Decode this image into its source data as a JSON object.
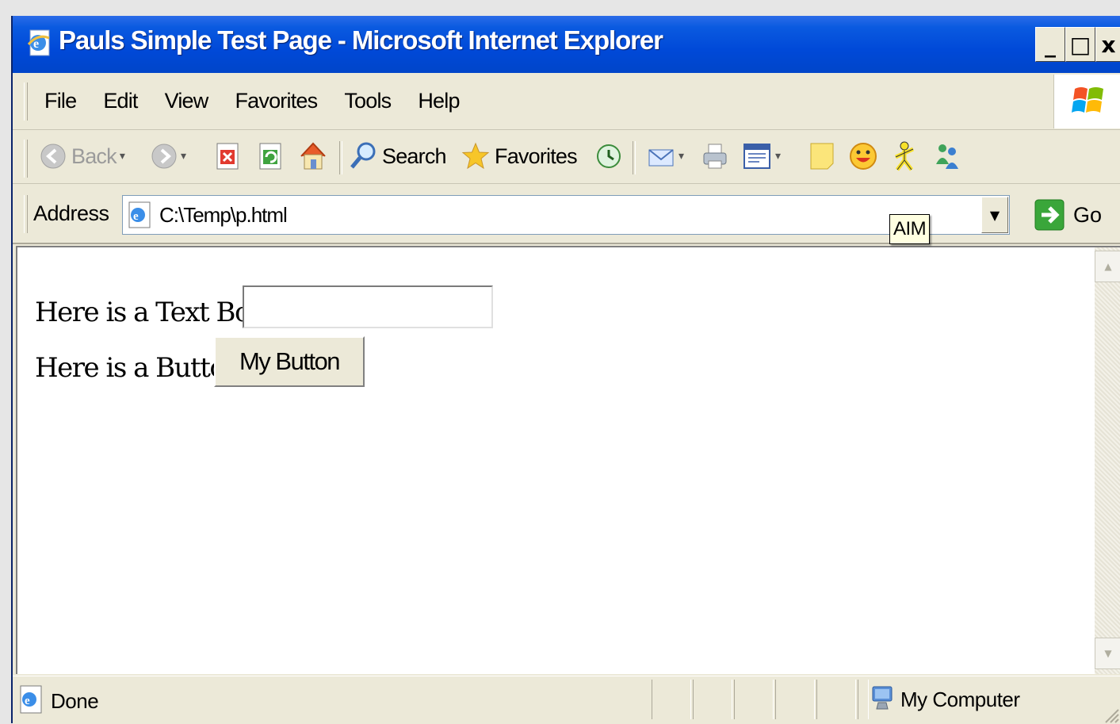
{
  "window": {
    "title": "Pauls Simple Test Page - Microsoft Internet Explorer",
    "controls": {
      "minimize": "_",
      "maximize": "□",
      "close": "x"
    }
  },
  "menubar": {
    "items": [
      {
        "label": "File"
      },
      {
        "label": "Edit"
      },
      {
        "label": "View"
      },
      {
        "label": "Favorites"
      },
      {
        "label": "Tools"
      },
      {
        "label": "Help"
      }
    ]
  },
  "toolbar": {
    "back_label": "Back",
    "search_label": "Search",
    "favorites_label": "Favorites",
    "icons": [
      "back-icon",
      "forward-icon",
      "stop-icon",
      "refresh-icon",
      "home-icon",
      "search-icon",
      "favorites-star-icon",
      "history-icon",
      "mail-icon",
      "print-icon",
      "edit-icon",
      "notes-icon",
      "messenger-smiley-icon",
      "aim-icon",
      "msn-messenger-icon"
    ]
  },
  "address": {
    "label": "Address",
    "url": "C:\\Temp\\p.html",
    "go_label": "Go"
  },
  "tooltip": {
    "text": "AIM"
  },
  "page": {
    "text_box_label": "Here is a Text Box",
    "text_box_value": "",
    "button_row_label": "Here is a Button",
    "button_label": "My Button"
  },
  "statusbar": {
    "status": "Done",
    "zone": "My Computer"
  },
  "colors": {
    "titlebar": "#0054e3",
    "chrome": "#ece9d8",
    "tooltip_bg": "#ffffe1"
  }
}
